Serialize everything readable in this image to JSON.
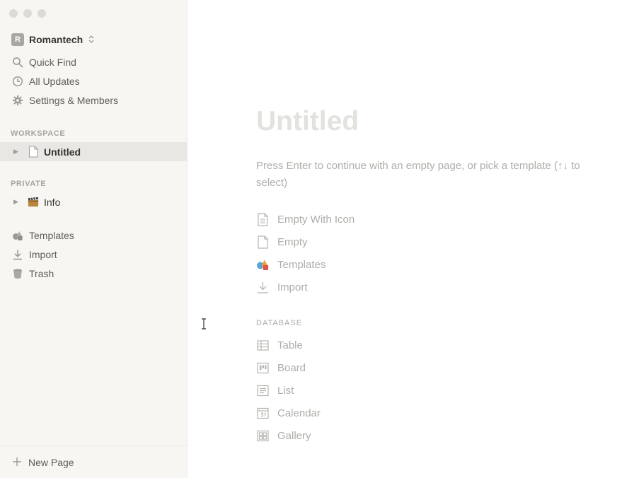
{
  "window": {
    "controls": [
      "close",
      "minimize",
      "maximize"
    ]
  },
  "workspace": {
    "avatar_letter": "R",
    "name": "Romantech"
  },
  "sidebar": {
    "nav": [
      {
        "label": "Quick Find",
        "icon": "search-icon"
      },
      {
        "label": "All Updates",
        "icon": "clock-icon"
      },
      {
        "label": "Settings & Members",
        "icon": "gear-icon"
      }
    ],
    "workspace_section": {
      "label": "WORKSPACE",
      "items": [
        {
          "label": "Untitled",
          "icon": "page-icon",
          "selected": true
        }
      ]
    },
    "private_section": {
      "label": "PRIVATE",
      "items": [
        {
          "label": "Info",
          "icon": "clapperboard-icon"
        }
      ]
    },
    "tools": [
      {
        "label": "Templates",
        "icon": "shapes-icon"
      },
      {
        "label": "Import",
        "icon": "download-icon"
      },
      {
        "label": "Trash",
        "icon": "trash-icon"
      }
    ],
    "footer": {
      "label": "New Page",
      "icon": "plus-icon"
    }
  },
  "main": {
    "title": "Untitled",
    "hint": "Press Enter to continue with an empty page, or pick a template (↑↓ to select)",
    "templates": [
      {
        "label": "Empty With Icon",
        "icon": "page-with-lines-icon"
      },
      {
        "label": "Empty",
        "icon": "page-icon"
      },
      {
        "label": "Templates",
        "icon": "shapes-icon"
      },
      {
        "label": "Import",
        "icon": "download-icon"
      }
    ],
    "database_label": "DATABASE",
    "databases": [
      {
        "label": "Table",
        "icon": "table-icon"
      },
      {
        "label": "Board",
        "icon": "board-icon"
      },
      {
        "label": "List",
        "icon": "list-icon"
      },
      {
        "label": "Calendar",
        "icon": "calendar-icon"
      },
      {
        "label": "Gallery",
        "icon": "gallery-icon"
      }
    ]
  },
  "colors": {
    "sidebar_bg": "#f7f6f3",
    "selected_bg": "#e8e7e4",
    "text": "#37352f",
    "muted": "#aeada9"
  }
}
